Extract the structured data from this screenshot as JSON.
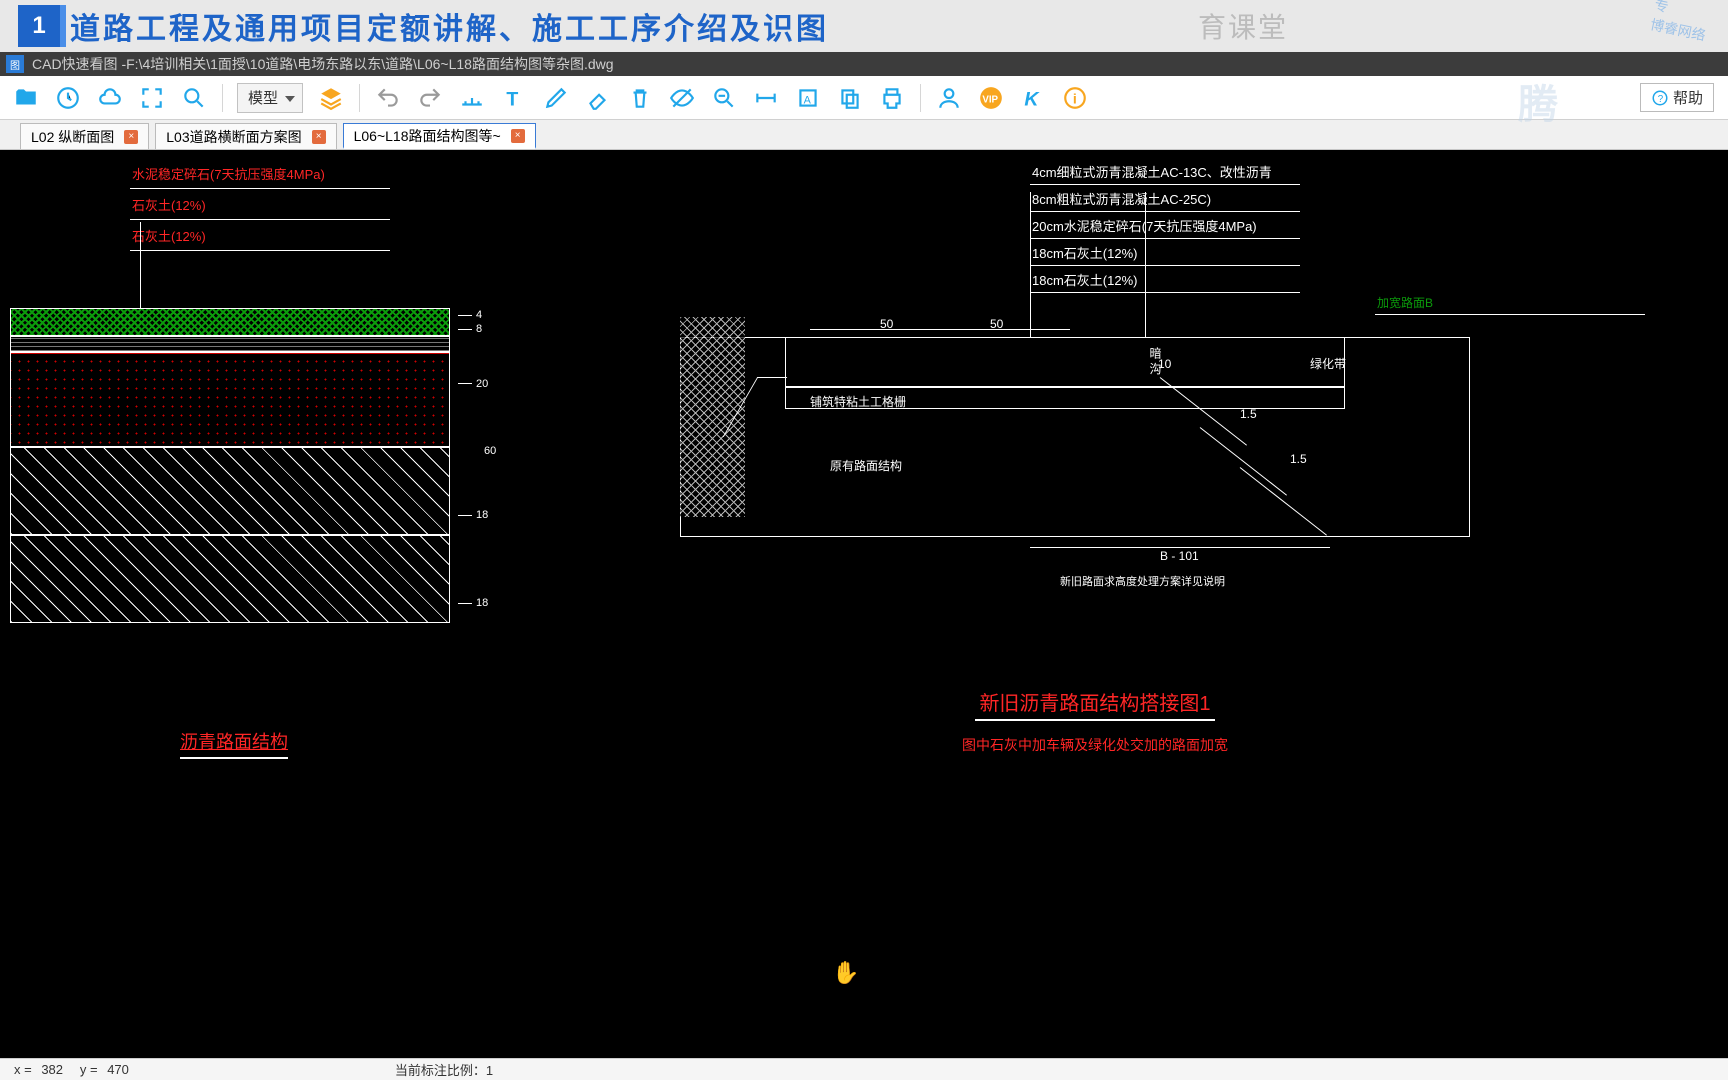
{
  "banner": {
    "badge_num": "1",
    "title": "道路工程及通用项目定额讲解、施工工序介绍及识图",
    "faded_text": "育课堂",
    "corner_text1": "专",
    "corner_text2": "博睿网络"
  },
  "app": {
    "name_prefix": "CAD快速看图 - ",
    "file_path": "F:\\4培训相关\\1面授\\10道路\\电场东路以东\\道路\\L06~L18路面结构图等杂图.dwg",
    "icon_text": "图"
  },
  "toolbar": {
    "view_mode": "模型",
    "help_label": "帮助"
  },
  "tabs": [
    {
      "label": "L02 纵断面图",
      "active": false
    },
    {
      "label": "L03道路横断面方案图",
      "active": false
    },
    {
      "label": "L06~L18路面结构图等~",
      "active": true
    }
  ],
  "left_drawing": {
    "labels": [
      "水泥稳定碎石(7天抗压强度4MPa)",
      "石灰土(12%)",
      "石灰土(12%)"
    ],
    "dims": [
      "4",
      "8",
      "20",
      "60",
      "18",
      "18"
    ],
    "title": "沥青路面结构"
  },
  "right_drawing": {
    "labels": [
      "4cm细粒式沥青混凝土AC-13C、改性沥青",
      "8cm粗粒式沥青混凝土AC-25C)",
      "20cm水泥稳定碎石(7天抗压强度4MPa)",
      "18cm石灰土(12%)",
      "18cm石灰土(12%)"
    ],
    "green_label": "加宽路面B",
    "dim_50a": "50",
    "dim_50b": "50",
    "dim_10": "10",
    "dim_15a": "1.5",
    "dim_15b": "1.5",
    "label_soil": "铺筑特粘土工格栅",
    "label_old": "原有路面结构",
    "label_new": "绿化带",
    "label_conn": "暗 沟",
    "dim_b": "B - 101",
    "caption": "新旧路面求高度处理方案详见说明",
    "title": "新旧沥青路面结构搭接图1",
    "subtitle": "图中石灰中加车辆及绿化处交加的路面加宽"
  },
  "status": {
    "x_label": "x = ",
    "x_val": "382",
    "y_label": "y = ",
    "y_val": "470",
    "scale_label": "当前标注比例：",
    "scale_val": "1"
  },
  "icons": {
    "open": "open-folder-icon",
    "recent": "recent-icon",
    "cloud": "cloud-icon",
    "fullextent": "fit-window-icon",
    "zoom": "zoom-icon",
    "layers": "layers-icon",
    "undo": "undo-icon",
    "redo": "redo-icon",
    "measure": "measure-line-icon",
    "text": "text-icon",
    "pencil": "pencil-icon",
    "eraser": "eraser-icon",
    "delete": "delete-icon",
    "hide": "hide-icon",
    "find": "find-icon",
    "dim": "dimension-icon",
    "area": "area-icon",
    "copy": "copy-icon",
    "print": "print-icon",
    "user": "user-icon",
    "vip": "vip-icon",
    "k": "k-icon",
    "info": "info-icon"
  },
  "colors": {
    "blue": "#21a7ea",
    "orange": "#f8a61f",
    "gray": "#9a9a9a"
  }
}
